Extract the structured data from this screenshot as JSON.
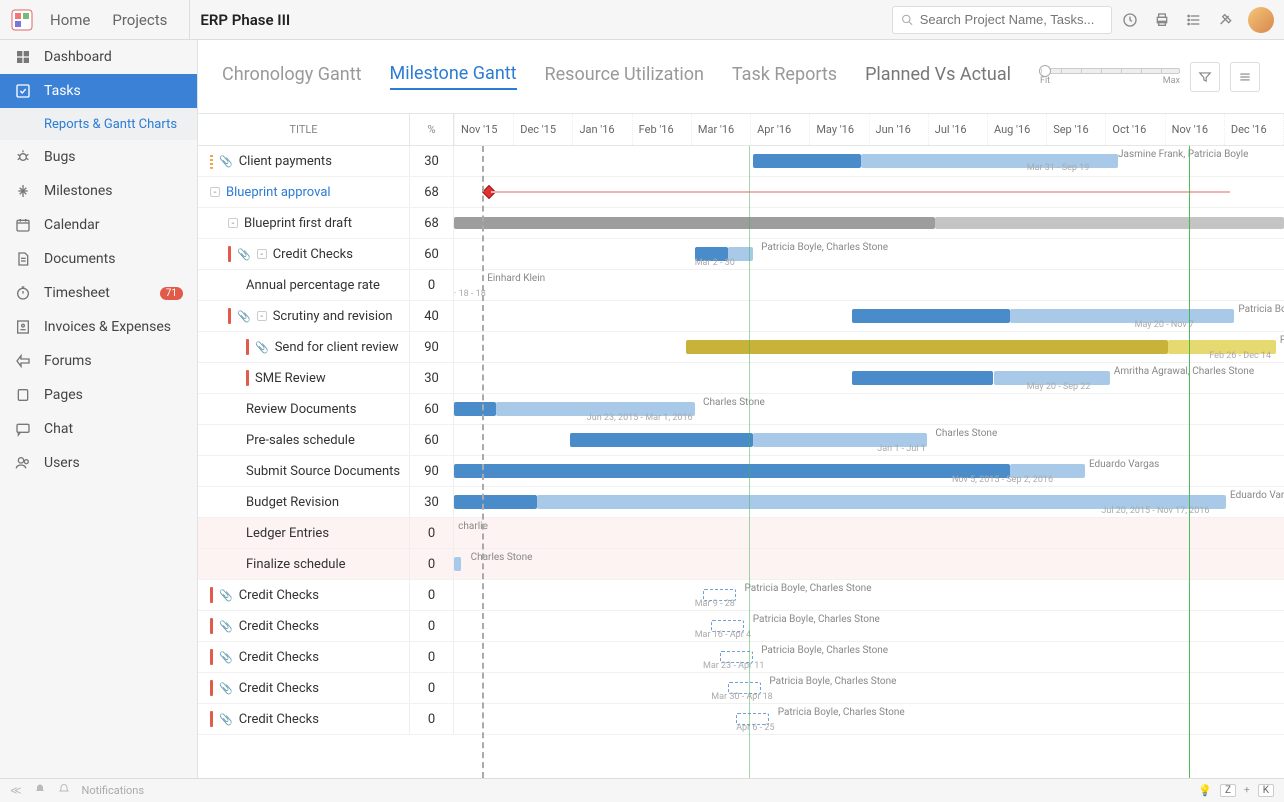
{
  "topbar": {
    "home": "Home",
    "projects": "Projects",
    "title": "ERP Phase III",
    "search_placeholder": "Search Project Name, Tasks..."
  },
  "sidebar": {
    "items": [
      {
        "label": "Dashboard",
        "icon": "dashboard"
      },
      {
        "label": "Tasks",
        "icon": "tasks",
        "active": true,
        "sub": "Reports & Gantt Charts"
      },
      {
        "label": "Bugs",
        "icon": "bug"
      },
      {
        "label": "Milestones",
        "icon": "milestone"
      },
      {
        "label": "Calendar",
        "icon": "calendar"
      },
      {
        "label": "Documents",
        "icon": "docs"
      },
      {
        "label": "Timesheet",
        "icon": "timer",
        "badge": "71"
      },
      {
        "label": "Invoices & Expenses",
        "icon": "invoice"
      },
      {
        "label": "Forums",
        "icon": "forums"
      },
      {
        "label": "Pages",
        "icon": "pages"
      },
      {
        "label": "Chat",
        "icon": "chat"
      },
      {
        "label": "Users",
        "icon": "users"
      }
    ]
  },
  "tabs": {
    "chronology": "Chronology Gantt",
    "milestone": "Milestone Gantt",
    "resource": "Resource Utilization",
    "task": "Task Reports",
    "planned": "Planned Vs Actual",
    "slider_fit": "Fit",
    "slider_max": "Max"
  },
  "headers": {
    "title": "TITLE",
    "pct": "%"
  },
  "months": [
    "Nov '15",
    "Dec '15",
    "Jan '16",
    "Feb '16",
    "Mar '16",
    "Apr '16",
    "May '16",
    "Jun '16",
    "Jul '16",
    "Aug '16",
    "Sep '16",
    "Oct '16",
    "Nov '16",
    "Dec '16"
  ],
  "rows": [
    {
      "ind": "yellow",
      "attach": true,
      "title": "Client payments",
      "pct": "30",
      "bars": [
        {
          "cls": "blue",
          "l": 36,
          "w": 13
        },
        {
          "cls": "lblue",
          "l": 49,
          "w": 31
        }
      ],
      "label": "Jasmine Frank, Patricia Boyle",
      "label_l": 80,
      "sub": "Mar 31 - Sep 19",
      "sub_l": 69
    },
    {
      "exp": "-",
      "title": "Blueprint approval",
      "title_blue": true,
      "pct": "68",
      "diamond": 3.6,
      "redline": {
        "l": 4.5,
        "w": 89
      }
    },
    {
      "indent": 1,
      "exp": "-",
      "title": "Blueprint first draft",
      "pct": "68",
      "bars": [
        {
          "cls": "grey",
          "l": 0,
          "w": 58
        },
        {
          "cls": "grey",
          "l": 58,
          "w": 42,
          "op": 0.6
        }
      ]
    },
    {
      "ind": "red",
      "attach": true,
      "indent": 1,
      "exp": "-",
      "title": "Credit Checks",
      "pct": "60",
      "bars": [
        {
          "cls": "blue",
          "l": 29,
          "w": 4
        },
        {
          "cls": "lblue",
          "l": 33,
          "w": 3
        }
      ],
      "label": "Patricia Boyle, Charles Stone",
      "label_l": 37,
      "sub": "Mar 2 - 30",
      "sub_l": 29,
      "sub_below": true
    },
    {
      "indent": 2,
      "title": "Annual percentage rate",
      "pct": "0",
      "label": "Einhard Klein",
      "label_l": 4,
      "sub": "· 18 - 18",
      "sub_l": 0,
      "sub_below": true
    },
    {
      "ind": "red",
      "attach": true,
      "indent": 1,
      "exp": "-",
      "title": "Scrutiny and revision",
      "pct": "40",
      "bars": [
        {
          "cls": "blue",
          "l": 48,
          "w": 19
        },
        {
          "cls": "lblue",
          "l": 67,
          "w": 27
        }
      ],
      "label": "Patricia Boyle",
      "label_l": 94.5,
      "sub": "May 20 - Nov 7",
      "sub_l": 82,
      "sub_below": true
    },
    {
      "ind": "red",
      "attach": true,
      "indent": 2,
      "title": "Send for client review",
      "pct": "90",
      "bars": [
        {
          "cls": "yellow",
          "l": 28,
          "w": 58
        },
        {
          "cls": "lyellow",
          "l": 86,
          "w": 13
        }
      ],
      "label": "Fathin",
      "label_l": 99.5,
      "sub": "Feb 26 - Dec 14",
      "sub_l": 91,
      "sub_below": true
    },
    {
      "ind": "red",
      "indent": 2,
      "title": "SME Review",
      "pct": "30",
      "bars": [
        {
          "cls": "blue",
          "l": 48,
          "w": 17
        },
        {
          "cls": "lblue",
          "l": 65,
          "w": 14
        }
      ],
      "label": "Amritha Agrawal, Charles Stone",
      "label_l": 79.5,
      "sub": "May 20 - Sep 22",
      "sub_l": 69,
      "sub_below": true
    },
    {
      "indent": 2,
      "title": "Review Documents",
      "pct": "60",
      "bars": [
        {
          "cls": "blue",
          "l": 0,
          "w": 5
        },
        {
          "cls": "lblue",
          "l": 5,
          "w": 24
        }
      ],
      "label": "Charles Stone",
      "label_l": 30,
      "sub": "Jun 23, 2015 - Mar 1, 2016",
      "sub_l": 16,
      "sub_below": true
    },
    {
      "indent": 2,
      "title": "Pre-sales schedule",
      "pct": "60",
      "bars": [
        {
          "cls": "blue",
          "l": 14,
          "w": 22
        },
        {
          "cls": "lblue",
          "l": 36,
          "w": 21
        }
      ],
      "label": "Charles Stone",
      "label_l": 58,
      "sub": "Jan 1 - Jul 1",
      "sub_l": 51,
      "sub_below": true
    },
    {
      "indent": 2,
      "title": "Submit Source Documents",
      "pct": "90",
      "bars": [
        {
          "cls": "blue",
          "l": 0,
          "w": 67
        },
        {
          "cls": "lblue",
          "l": 67,
          "w": 9
        }
      ],
      "label": "Eduardo Vargas",
      "label_l": 76.5,
      "sub": "Nov 5, 2015 - Sep 2, 2016",
      "sub_l": 60,
      "sub_below": true
    },
    {
      "indent": 2,
      "title": "Budget Revision",
      "pct": "30",
      "bars": [
        {
          "cls": "blue",
          "l": 0,
          "w": 10
        },
        {
          "cls": "lblue",
          "l": 10,
          "w": 83
        }
      ],
      "label": "Eduardo Vargas",
      "label_l": 93.5,
      "sub": "Jul 20, 2015 - Nov 17, 2016",
      "sub_l": 78,
      "sub_below": true
    },
    {
      "pink": true,
      "indent": 2,
      "title": "Ledger Entries",
      "pct": "0",
      "label": "charlie",
      "label_l": 0.5
    },
    {
      "pink": true,
      "indent": 2,
      "title": "Finalize schedule",
      "pct": "0",
      "bars": [
        {
          "cls": "lblue",
          "l": 0,
          "w": 0.8
        }
      ],
      "label": "Charles Stone",
      "label_l": 2
    },
    {
      "ind": "red",
      "attach": true,
      "title": "Credit Checks",
      "pct": "0",
      "bars": [
        {
          "cls": "dashed",
          "l": 30,
          "w": 4
        }
      ],
      "label": "Patricia Boyle, Charles Stone",
      "label_l": 35,
      "sub": "Mar 9 - 28",
      "sub_l": 29,
      "sub_below": true
    },
    {
      "ind": "red",
      "attach": true,
      "title": "Credit Checks",
      "pct": "0",
      "bars": [
        {
          "cls": "dashed",
          "l": 31,
          "w": 4
        }
      ],
      "label": "Patricia Boyle, Charles Stone",
      "label_l": 36,
      "sub": "Mar 16 - Apr 4",
      "sub_l": 29,
      "sub_below": true
    },
    {
      "ind": "red",
      "attach": true,
      "title": "Credit Checks",
      "pct": "0",
      "bars": [
        {
          "cls": "dashed",
          "l": 32,
          "w": 4
        }
      ],
      "label": "Patricia Boyle, Charles Stone",
      "label_l": 37,
      "sub": "Mar 23 - Apr 11",
      "sub_l": 30,
      "sub_below": true
    },
    {
      "ind": "red",
      "attach": true,
      "title": "Credit Checks",
      "pct": "0",
      "bars": [
        {
          "cls": "dashed",
          "l": 33,
          "w": 4
        }
      ],
      "label": "Patricia Boyle, Charles Stone",
      "label_l": 38,
      "sub": "Mar 30 - Apr 18",
      "sub_l": 31,
      "sub_below": true
    },
    {
      "ind": "red",
      "attach": true,
      "title": "Credit Checks",
      "pct": "0",
      "bars": [
        {
          "cls": "dashed",
          "l": 34,
          "w": 4
        }
      ],
      "label": "Patricia Boyle, Charles Stone",
      "label_l": 39,
      "sub": "Apr 6 - 25",
      "sub_l": 34,
      "sub_below": true
    }
  ],
  "footer": {
    "notifications": "Notifications",
    "kbd1": "Z",
    "kbd_plus": "+",
    "kbd2": "K"
  },
  "chart_data": {
    "type": "gantt",
    "xlabel": "Month",
    "x_range": [
      "Nov 2015",
      "Dec 2016"
    ],
    "tasks": [
      {
        "name": "Client payments",
        "pct": 30,
        "planned": [
          "2016-03-31",
          "2016-09-19"
        ],
        "assignees": [
          "Jasmine Frank",
          "Patricia Boyle"
        ]
      },
      {
        "name": "Blueprint approval",
        "pct": 68,
        "milestone": "2015-11-10"
      },
      {
        "name": "Blueprint first draft",
        "pct": 68,
        "bar": [
          "2015-10-01",
          "2016-12-31"
        ]
      },
      {
        "name": "Credit Checks",
        "pct": 60,
        "planned": [
          "2016-03-02",
          "2016-03-30"
        ],
        "assignees": [
          "Patricia Boyle",
          "Charles Stone"
        ]
      },
      {
        "name": "Annual percentage rate",
        "pct": 0,
        "assignees": [
          "Einhard Klein"
        ],
        "dates": "18 - 18"
      },
      {
        "name": "Scrutiny and revision",
        "pct": 40,
        "planned": [
          "2016-05-20",
          "2016-11-07"
        ],
        "assignees": [
          "Patricia Boyle"
        ]
      },
      {
        "name": "Send for client review",
        "pct": 90,
        "planned": [
          "2016-02-26",
          "2016-12-14"
        ],
        "assignees": [
          "Fathin"
        ]
      },
      {
        "name": "SME Review",
        "pct": 30,
        "planned": [
          "2016-05-20",
          "2016-09-22"
        ],
        "assignees": [
          "Amritha Agrawal",
          "Charles Stone"
        ]
      },
      {
        "name": "Review Documents",
        "pct": 60,
        "planned": [
          "2015-06-23",
          "2016-03-01"
        ],
        "assignees": [
          "Charles Stone"
        ]
      },
      {
        "name": "Pre-sales schedule",
        "pct": 60,
        "planned": [
          "2016-01-01",
          "2016-07-01"
        ],
        "assignees": [
          "Charles Stone"
        ]
      },
      {
        "name": "Submit Source Documents",
        "pct": 90,
        "planned": [
          "2015-11-05",
          "2016-09-02"
        ],
        "assignees": [
          "Eduardo Vargas"
        ]
      },
      {
        "name": "Budget Revision",
        "pct": 30,
        "planned": [
          "2015-07-20",
          "2016-11-17"
        ],
        "assignees": [
          "Eduardo Vargas"
        ]
      },
      {
        "name": "Ledger Entries",
        "pct": 0,
        "assignees": [
          "charlie"
        ]
      },
      {
        "name": "Finalize schedule",
        "pct": 0,
        "assignees": [
          "Charles Stone"
        ]
      },
      {
        "name": "Credit Checks",
        "pct": 0,
        "planned": [
          "2016-03-09",
          "2016-03-28"
        ],
        "assignees": [
          "Patricia Boyle",
          "Charles Stone"
        ]
      },
      {
        "name": "Credit Checks",
        "pct": 0,
        "planned": [
          "2016-03-16",
          "2016-04-04"
        ],
        "assignees": [
          "Patricia Boyle",
          "Charles Stone"
        ]
      },
      {
        "name": "Credit Checks",
        "pct": 0,
        "planned": [
          "2016-03-23",
          "2016-04-11"
        ],
        "assignees": [
          "Patricia Boyle",
          "Charles Stone"
        ]
      },
      {
        "name": "Credit Checks",
        "pct": 0,
        "planned": [
          "2016-03-30",
          "2016-04-18"
        ],
        "assignees": [
          "Patricia Boyle",
          "Charles Stone"
        ]
      },
      {
        "name": "Credit Checks",
        "pct": 0,
        "planned": [
          "2016-04-06",
          "2016-04-25"
        ],
        "assignees": [
          "Patricia Boyle",
          "Charles Stone"
        ]
      }
    ]
  }
}
